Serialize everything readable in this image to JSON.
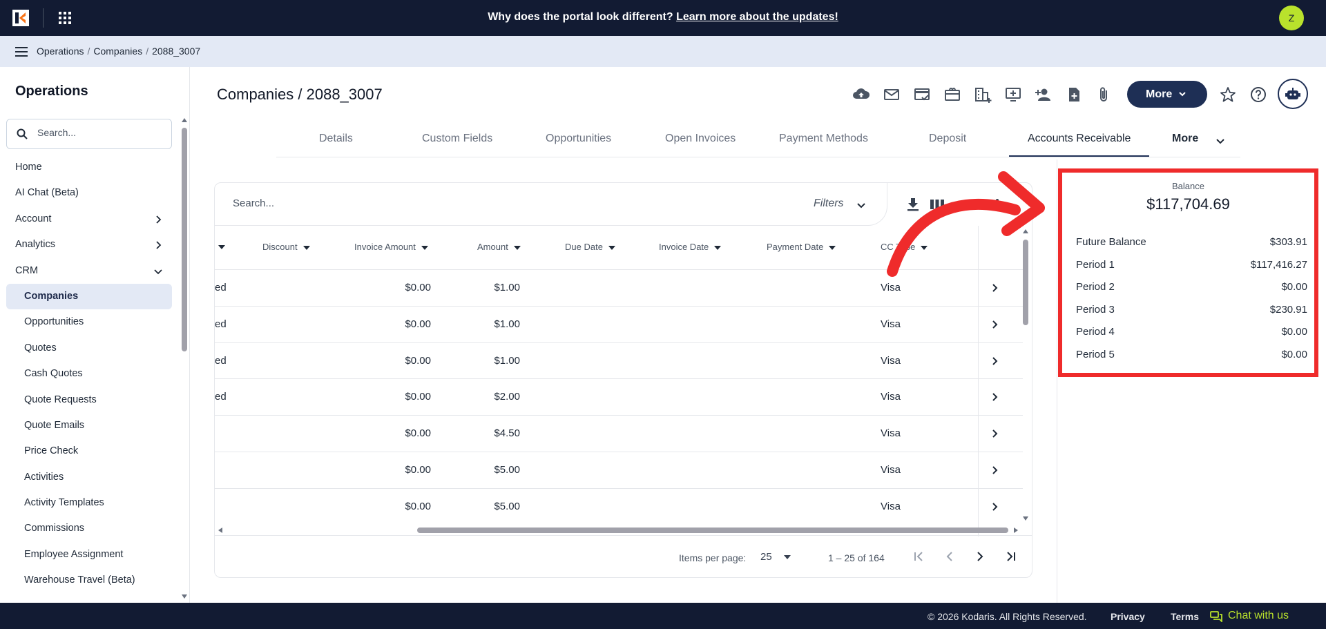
{
  "topbar": {
    "announcement_text": "Why does the portal look different?",
    "announcement_link": "Learn more about the updates!",
    "avatar_initial": "Z"
  },
  "breadcrumb": {
    "items": [
      "Operations",
      "Companies",
      "2088_3007"
    ]
  },
  "sidebar": {
    "title": "Operations",
    "search_placeholder": "Search...",
    "items": [
      {
        "label": "Home"
      },
      {
        "label": "AI Chat (Beta)"
      },
      {
        "label": "Account"
      },
      {
        "label": "Analytics"
      },
      {
        "label": "CRM"
      },
      {
        "label": "Companies"
      },
      {
        "label": "Opportunities"
      },
      {
        "label": "Quotes"
      },
      {
        "label": "Cash Quotes"
      },
      {
        "label": "Quote Requests"
      },
      {
        "label": "Quote Emails"
      },
      {
        "label": "Price Check"
      },
      {
        "label": "Activities"
      },
      {
        "label": "Activity Templates"
      },
      {
        "label": "Commissions"
      },
      {
        "label": "Employee Assignment"
      },
      {
        "label": "Warehouse Travel (Beta)"
      }
    ]
  },
  "page": {
    "title": "Companies / 2088_3007",
    "more_label": "More"
  },
  "tabs": {
    "items": [
      "Details",
      "Custom Fields",
      "Opportunities",
      "Open Invoices",
      "Payment Methods",
      "Deposit",
      "Accounts Receivable"
    ],
    "more_label": "More"
  },
  "table": {
    "search_placeholder": "Search...",
    "filters_label": "Filters",
    "columns": [
      "Discount",
      "Invoice Amount",
      "Amount",
      "Due Date",
      "Invoice Date",
      "Payment Date",
      "CC Type"
    ],
    "rows": [
      {
        "status": "ed",
        "invoice_amount": "$0.00",
        "amount": "$1.00",
        "cc_type": "Visa"
      },
      {
        "status": "ed",
        "invoice_amount": "$0.00",
        "amount": "$1.00",
        "cc_type": "Visa"
      },
      {
        "status": "ed",
        "invoice_amount": "$0.00",
        "amount": "$1.00",
        "cc_type": "Visa"
      },
      {
        "status": "ed",
        "invoice_amount": "$0.00",
        "amount": "$2.00",
        "cc_type": "Visa"
      },
      {
        "status": "",
        "invoice_amount": "$0.00",
        "amount": "$4.50",
        "cc_type": "Visa"
      },
      {
        "status": "",
        "invoice_amount": "$0.00",
        "amount": "$5.00",
        "cc_type": "Visa"
      },
      {
        "status": "",
        "invoice_amount": "$0.00",
        "amount": "$5.00",
        "cc_type": "Visa"
      }
    ],
    "items_per_page_label": "Items per page:",
    "items_per_page": "25",
    "range_text": "1 – 25 of 164"
  },
  "balance": {
    "label": "Balance",
    "total": "$117,704.69",
    "rows": [
      {
        "label": "Future Balance",
        "value": "$303.91"
      },
      {
        "label": "Period 1",
        "value": "$117,416.27"
      },
      {
        "label": "Period 2",
        "value": "$0.00"
      },
      {
        "label": "Period 3",
        "value": "$230.91"
      },
      {
        "label": "Period 4",
        "value": "$0.00"
      },
      {
        "label": "Period 5",
        "value": "$0.00"
      }
    ],
    "highlight_color": "#ef2b2b"
  },
  "footer": {
    "copyright": "© 2026 Kodaris. All Rights Reserved.",
    "privacy": "Privacy",
    "terms": "Terms",
    "chat": "Chat with us"
  },
  "colors": {
    "nav_dark": "#121b33",
    "accent": "#1e2f55",
    "lime": "#b9e22c",
    "crumb_bg": "#e3e9f5"
  }
}
